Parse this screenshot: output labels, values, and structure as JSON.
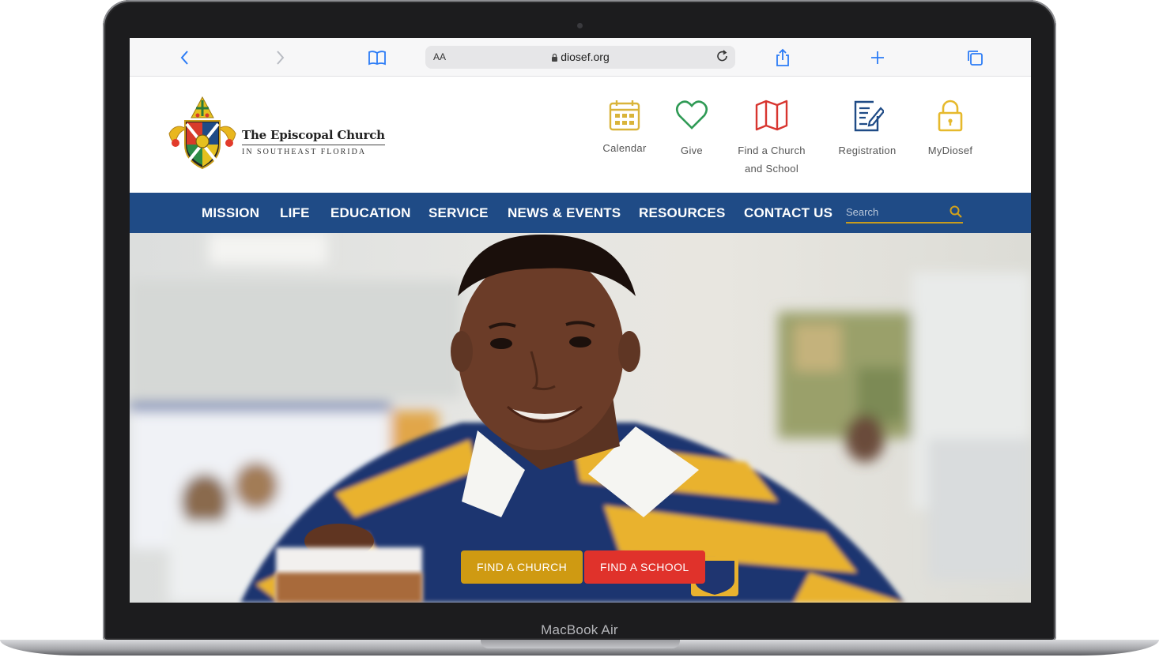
{
  "device": {
    "label": "MacBook Air"
  },
  "browser": {
    "aa_label": "AA",
    "url": "diosef.org"
  },
  "site": {
    "brand_title": "The Episcopal Church",
    "brand_subtitle": "IN SOUTHEAST FLORIDA",
    "quick_links": [
      {
        "label": "Calendar",
        "icon": "calendar-icon",
        "color": "#d9b43a"
      },
      {
        "label": "Give",
        "icon": "heart-icon",
        "color": "#2f9a55"
      },
      {
        "label": "Find a Church and School",
        "icon": "map-icon",
        "color": "#d8352f"
      },
      {
        "label": "Registration",
        "icon": "document-edit-icon",
        "color": "#1f4b86"
      },
      {
        "label": "MyDiosef",
        "icon": "lock-icon",
        "color": "#e6b92c"
      }
    ],
    "nav": [
      "MISSION",
      "LIFE",
      "EDUCATION",
      "SERVICE",
      "NEWS & EVENTS",
      "RESOURCES",
      "CONTACT US"
    ],
    "search_placeholder": "Search",
    "hero": {
      "find_church_label": "FIND A CHURCH",
      "find_school_label": "FIND A SCHOOL"
    }
  },
  "colors": {
    "nav_bg": "#1f4b86",
    "accent_gold": "#cf9a12",
    "accent_red": "#e0322b"
  }
}
